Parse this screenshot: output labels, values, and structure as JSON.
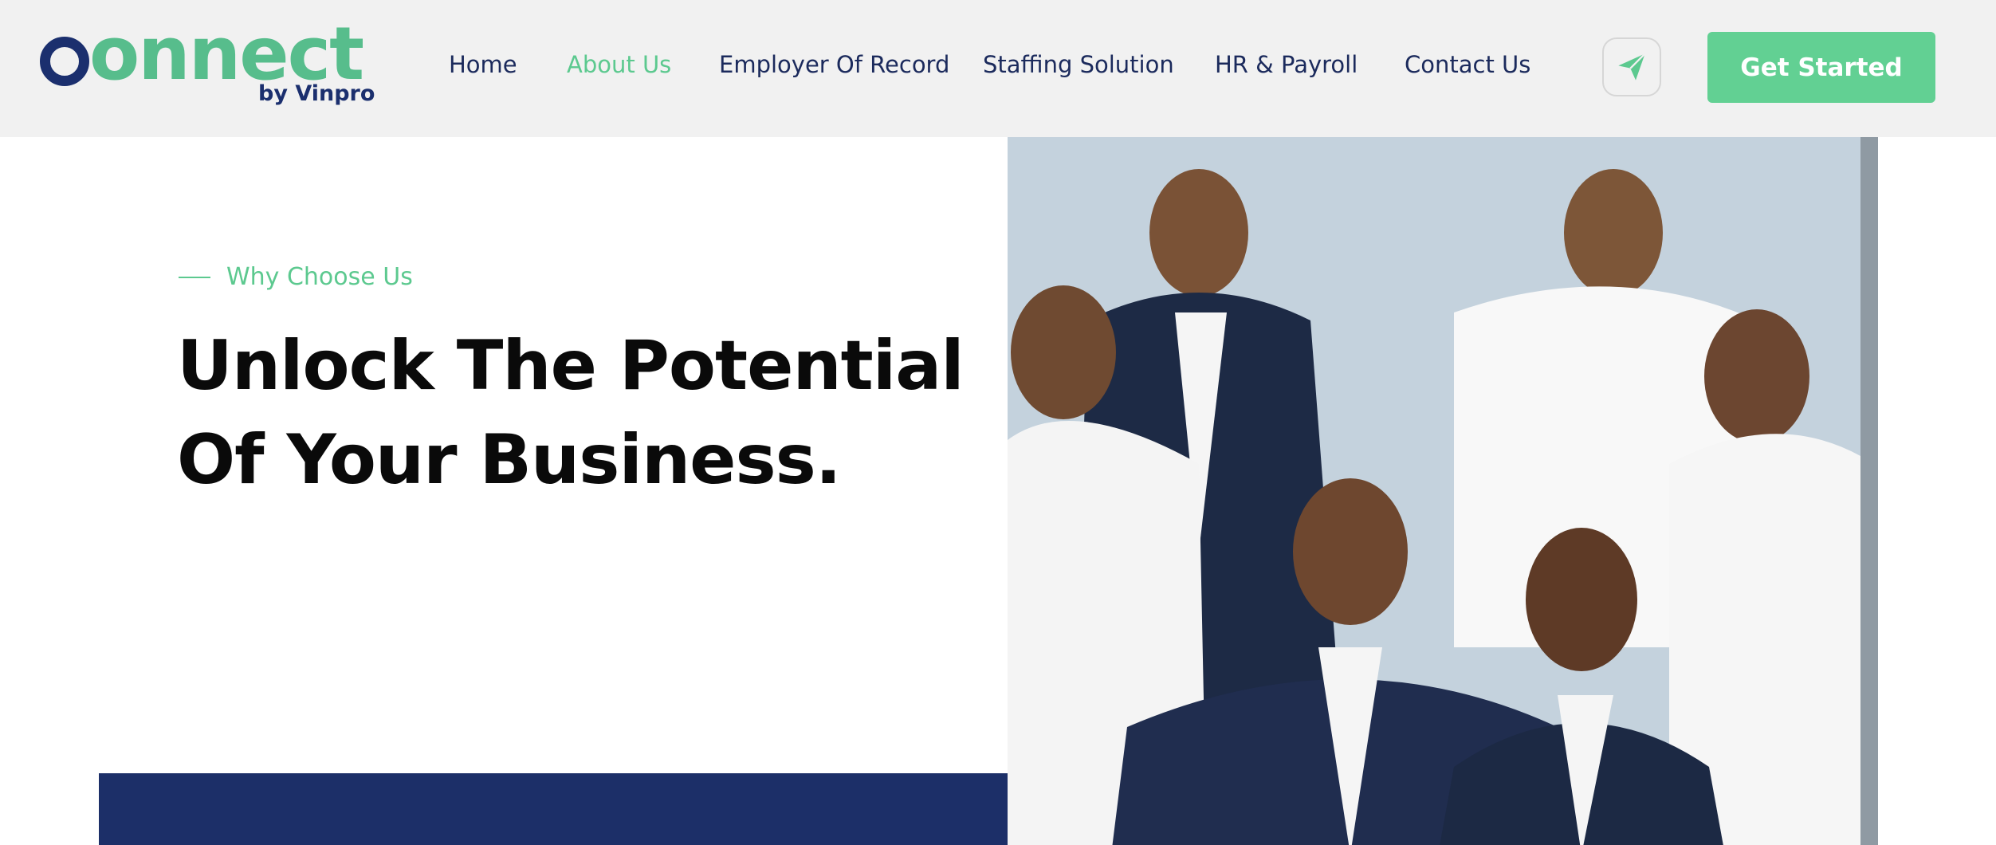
{
  "brand": {
    "logo_word": "onnect",
    "logo_sub": "by Vinpro"
  },
  "nav": {
    "items": [
      {
        "label": "Home",
        "active": false
      },
      {
        "label": "About Us",
        "active": true
      },
      {
        "label": "Employer Of Record",
        "active": false
      },
      {
        "label": "Staffing Solution",
        "active": false
      },
      {
        "label": "HR & Payroll",
        "active": false
      },
      {
        "label": "Contact Us",
        "active": false
      }
    ]
  },
  "header": {
    "send_icon": "paper-plane-icon",
    "cta_label": "Get Started"
  },
  "hero": {
    "eyebrow": "Why Choose Us",
    "headline_line1": "Unlock The Potential",
    "headline_line2": "Of Your Business."
  },
  "colors": {
    "brand_green": "#5cc98f",
    "brand_navy": "#1b2f6e",
    "cta_green": "#62d093",
    "header_bg": "#f1f1f1"
  }
}
